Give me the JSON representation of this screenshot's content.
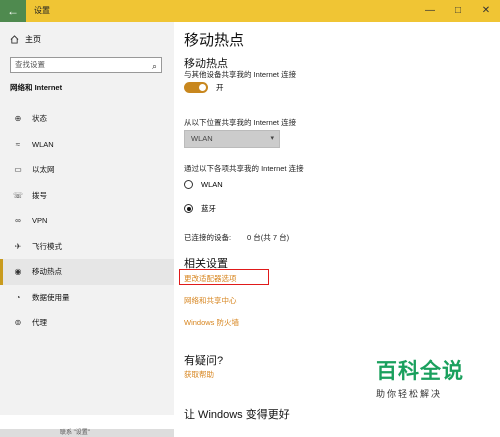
{
  "window": {
    "title": "设置",
    "back_glyph": "←",
    "minimize_glyph": "—",
    "maximize_glyph": "□",
    "close_glyph": "✕"
  },
  "sidebar": {
    "home_label": "主页",
    "search_placeholder": "查找设置",
    "section_title": "网络和 Internet",
    "items": [
      {
        "label": "状态",
        "icon": "globe-icon"
      },
      {
        "label": "WLAN",
        "icon": "wifi-icon"
      },
      {
        "label": "以太网",
        "icon": "ethernet-icon"
      },
      {
        "label": "拨号",
        "icon": "phone-icon"
      },
      {
        "label": "VPN",
        "icon": "vpn-icon"
      },
      {
        "label": "飞行模式",
        "icon": "airplane-icon"
      },
      {
        "label": "移动热点",
        "icon": "hotspot-icon",
        "active": true
      },
      {
        "label": "数据使用量",
        "icon": "data-usage-icon"
      },
      {
        "label": "代理",
        "icon": "proxy-icon"
      }
    ]
  },
  "main": {
    "page_title": "移动热点",
    "hotspot": {
      "heading": "移动热点",
      "share_desc": "与其他设备共享我的 Internet 连接",
      "toggle_state": "开"
    },
    "share_from": {
      "label": "从以下位置共享我的 Internet 连接",
      "selected": "WLAN"
    },
    "share_over": {
      "label": "通过以下各项共享我的 Internet 连接",
      "options": [
        "WLAN",
        "蓝牙"
      ],
      "selected_index": 1
    },
    "connected_devices": {
      "label": "已连接的设备:",
      "value": "0 台(共 7 台)"
    },
    "related": {
      "heading": "相关设置",
      "links": [
        "更改适配器选项",
        "网络和共享中心",
        "Windows 防火墙"
      ]
    },
    "help": {
      "heading": "有疑问?",
      "link": "获取帮助"
    },
    "partial_heading": "让 Windows 变得更好"
  },
  "watermark": {
    "main": "百科全说",
    "sub": "助你轻松解决"
  },
  "taskbar": {
    "text": "联系 \"设置\""
  },
  "colors": {
    "accent": "#d7851f",
    "titlebar": "#f0c534",
    "toggle_on": "#c8871e",
    "highlight_box": "#e01a1a",
    "watermark": "#1aa05d"
  }
}
